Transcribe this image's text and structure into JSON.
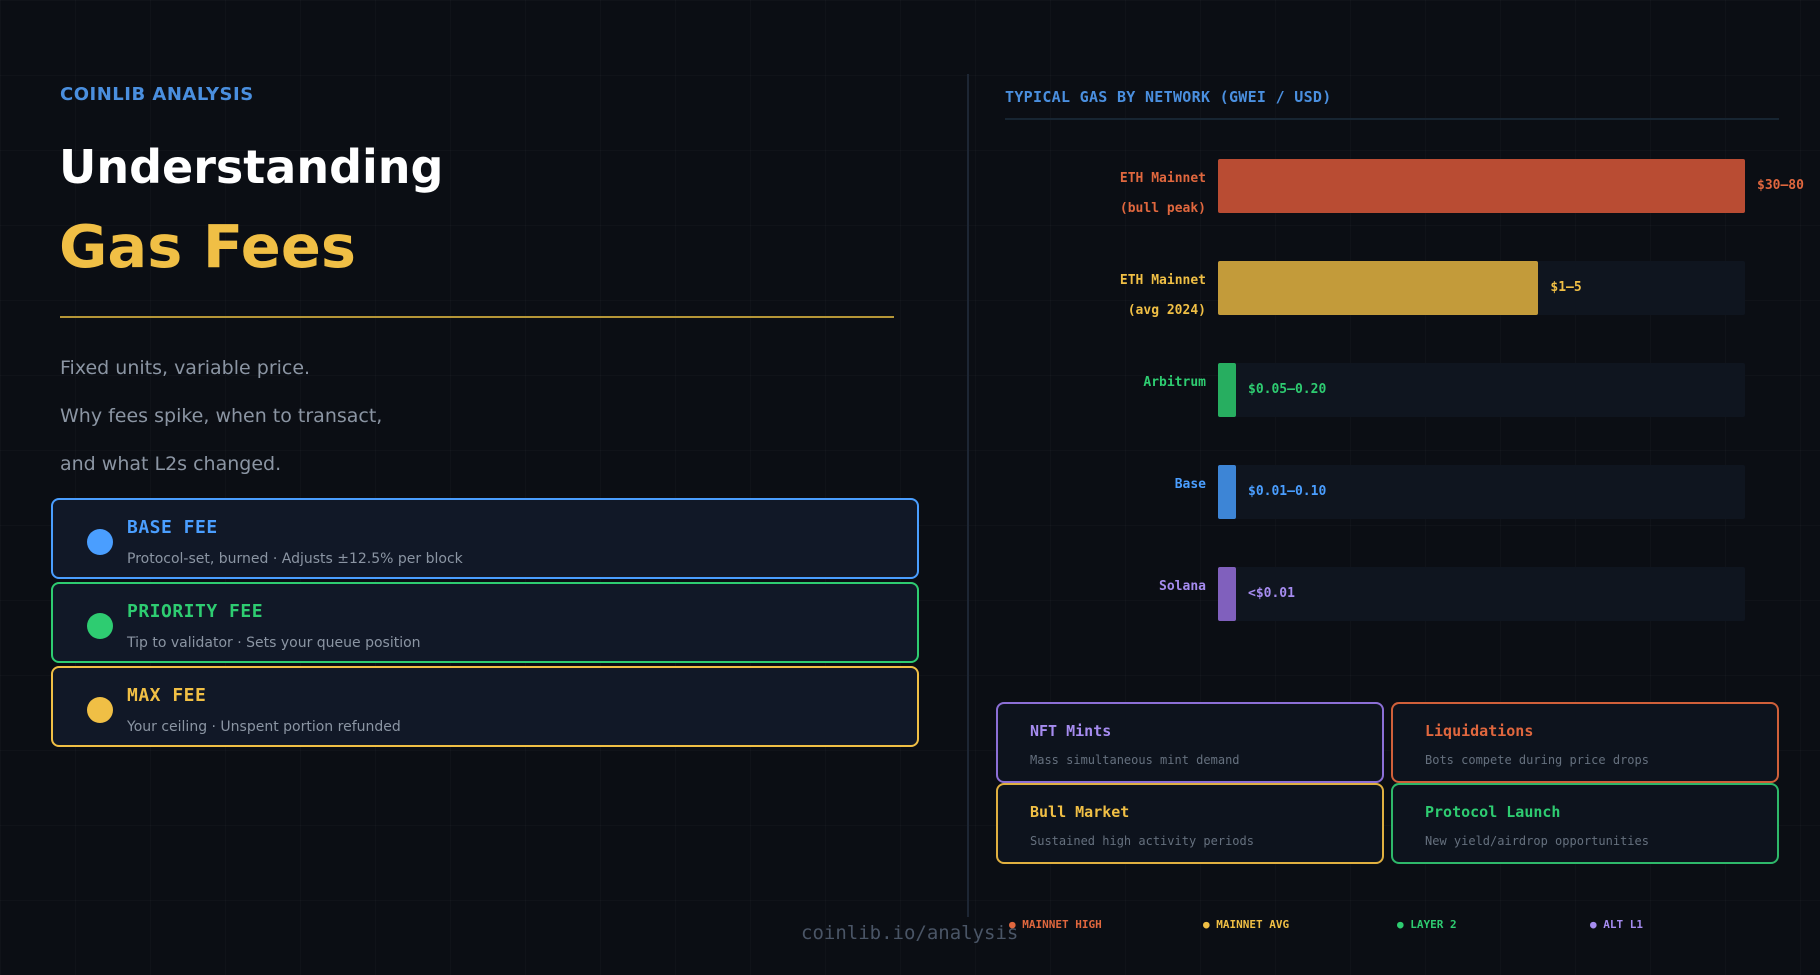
{
  "header": {
    "brand": "COINLIB ANALYSIS",
    "title_line1": "Understanding",
    "title_line2": "Gas Fees",
    "subtitle_lines": [
      "Fixed units, variable price.",
      "Why fees spike, when to transact,",
      "and what L2s changed."
    ]
  },
  "fee_types": [
    {
      "title": "BASE FEE",
      "desc": "Protocol-set, burned · Adjusts ±12.5% per block",
      "color": "#4a9eff"
    },
    {
      "title": "PRIORITY FEE",
      "desc": "Tip to validator · Sets your queue position",
      "color": "#2ecc71"
    },
    {
      "title": "MAX FEE",
      "desc": "Your ceiling · Unspent portion refunded",
      "color": "#f0bf45"
    }
  ],
  "chart_data": {
    "type": "bar",
    "title": "TYPICAL GAS BY NETWORK (GWEI / USD)",
    "orientation": "horizontal",
    "categories": [
      [
        "ETH Mainnet",
        "(bull peak)"
      ],
      [
        "ETH Mainnet",
        "(avg 2024)"
      ],
      [
        "Arbitrum"
      ],
      [
        "Base"
      ],
      [
        "Solana"
      ]
    ],
    "value_labels": [
      "$30–80",
      "$1–5",
      "$0.05–0.20",
      "$0.01–0.10",
      "<$0.01"
    ],
    "relative_values": [
      1.0,
      0.608,
      0.032,
      0.032,
      0.032
    ],
    "colors": [
      "#b94c33",
      "#c39b3a",
      "#27ae60",
      "#3d85d6",
      "#8060bd"
    ],
    "label_colors": [
      "#e0673e",
      "#f0bf45",
      "#2ecc71",
      "#4a9eff",
      "#a68cf0"
    ],
    "value_colors": [
      "#e0673e",
      "#f0bf45",
      "#2ecc71",
      "#4a9eff",
      "#a68cf0"
    ]
  },
  "triggers": [
    {
      "title": "NFT Mints",
      "desc": "Mass simultaneous mint demand",
      "color": "#a68cf0",
      "border": "#8c6fd6"
    },
    {
      "title": "Liquidations",
      "desc": "Bots compete during price drops",
      "color": "#e0673e",
      "border": "#d0603a"
    },
    {
      "title": "Bull Market",
      "desc": "Sustained high activity periods",
      "color": "#f0bf45",
      "border": "#e0b040"
    },
    {
      "title": "Protocol Launch",
      "desc": "New yield/airdrop opportunities",
      "color": "#2ecc71",
      "border": "#2eb86a"
    }
  ],
  "legend": [
    {
      "label": "● MAINNET HIGH",
      "color": "#e0673e"
    },
    {
      "label": "● MAINNET AVG",
      "color": "#f0bf45"
    },
    {
      "label": "● LAYER 2",
      "color": "#2ecc71"
    },
    {
      "label": "● ALT L1",
      "color": "#a68cf0"
    }
  ],
  "footer": "coinlib.io/analysis"
}
